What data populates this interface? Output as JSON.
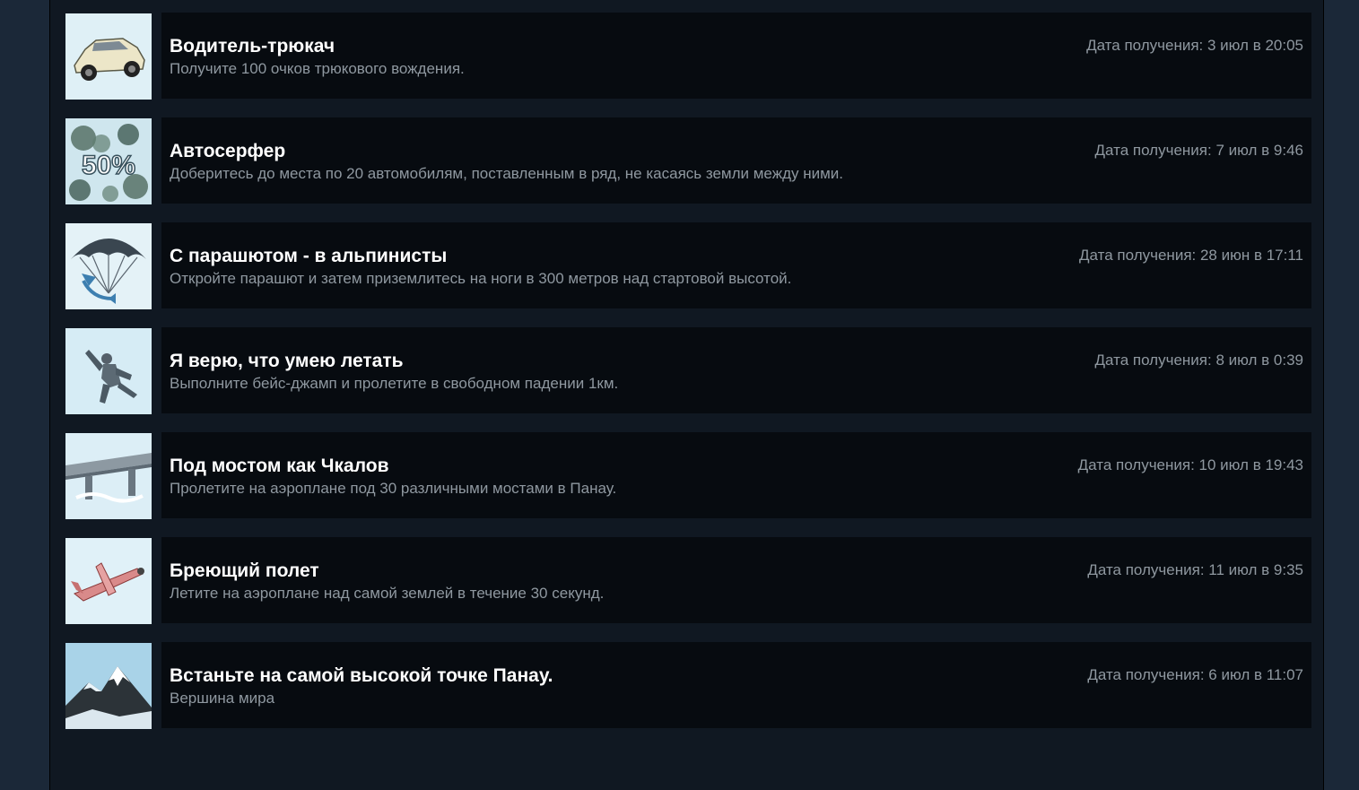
{
  "achievements": [
    {
      "icon": "stunt-car-icon",
      "title": "Водитель-трюкач",
      "description": "Получите 100 очков трюкового вождения.",
      "date": "Дата получения: 3 июл в 20:05"
    },
    {
      "icon": "car-surfer-50-percent-icon",
      "title": "Автосерфер",
      "description": "Доберитесь до места по 20 автомобилям, поставленным в ряд, не касаясь земли между ними.",
      "date": "Дата получения: 7 июл в 9:46",
      "icon_text": "50%"
    },
    {
      "icon": "parachute-icon",
      "title": "С парашютом - в альпинисты",
      "description": "Откройте парашют и затем приземлитесь на ноги в 300 метров над стартовой высотой.",
      "date": "Дата получения: 28 июн в 17:11"
    },
    {
      "icon": "skydiver-icon",
      "title": "Я верю, что умею летать",
      "description": "Выполните бейс-джамп и пролетите в свободном падении 1км.",
      "date": "Дата получения: 8 июл в 0:39"
    },
    {
      "icon": "bridge-icon",
      "title": "Под мостом как Чкалов",
      "description": "Пролетите на аэроплане под 30 различными мостами в Панау.",
      "date": "Дата получения: 10 июл в 19:43"
    },
    {
      "icon": "airplane-icon",
      "title": "Бреющий полет",
      "description": "Летите на аэроплане над самой землей в течение 30 секунд.",
      "date": "Дата получения: 11 июл в 9:35"
    },
    {
      "icon": "mountain-peak-icon",
      "title": "Встаньте на самой высокой точке Панау.",
      "description": "Вершина мира",
      "date": "Дата получения: 6 июл в 11:07"
    }
  ],
  "colors": {
    "background": "#1b2838",
    "panel": "#101822",
    "card": "#070b10",
    "title": "#ffffff",
    "secondary_text": "#8f98a0"
  }
}
